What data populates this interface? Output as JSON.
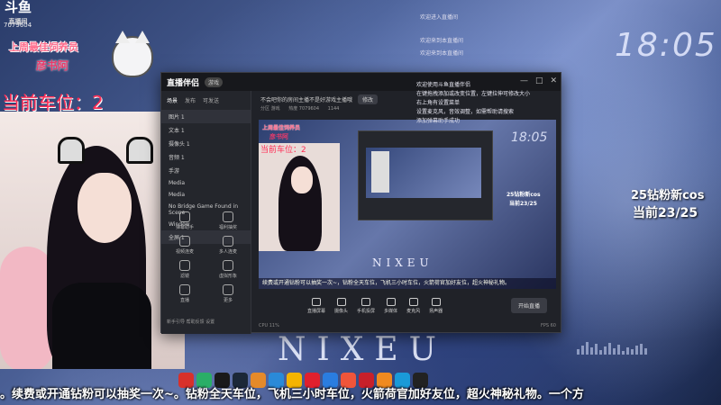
{
  "platform": {
    "logo_text": "斗鱼",
    "logo_sub": "直播间",
    "room_id": "7079604"
  },
  "badge": {
    "title": "上周最佳饲养员",
    "name": "彦书阿"
  },
  "car_position": "当前车位：2",
  "desktop": {
    "clock": "18:05",
    "brand": "NIXEU"
  },
  "overlay_right": {
    "line1": "25钻粉新cos",
    "line2": "当前23/25"
  },
  "notifications": [
    "欢迎进入直播间",
    "欢迎来到本直播间",
    "欢迎来到本直播间"
  ],
  "app": {
    "title": "直播伴侣",
    "version": "游戏",
    "window_controls": [
      "—",
      "□",
      "✕"
    ],
    "sidebar_tabs": [
      "场景",
      "发布",
      "可发送"
    ],
    "scenes": [
      {
        "label": "图片 1"
      },
      {
        "label": "文本 1"
      },
      {
        "label": "摄像头 1"
      },
      {
        "label": "音频 1"
      },
      {
        "label": "手游"
      },
      {
        "label": "Media"
      },
      {
        "label": "Media"
      },
      {
        "label": "No Bridge Game Found in Scene"
      },
      {
        "label": "Window"
      },
      {
        "label": "全屏 1"
      }
    ],
    "tools": [
      {
        "label": "弹幕助手",
        "icon": "headphones-icon"
      },
      {
        "label": "福利抽奖",
        "icon": "gift-icon"
      },
      {
        "label": "视频连麦",
        "icon": "video-call-icon"
      },
      {
        "label": "多人连麦",
        "icon": "group-icon"
      },
      {
        "label": "滤镜",
        "icon": "filter-icon"
      },
      {
        "label": "虚拟形象",
        "icon": "avatar-icon"
      },
      {
        "label": "直播",
        "icon": "broadcast-icon"
      },
      {
        "label": "更多",
        "icon": "more-icon"
      }
    ],
    "sidebar_footer": "新手引导  帮助反馈  设置",
    "top_info": "不会吧你的房间主播不是好游戏主播哦",
    "top_info_btn": "修改",
    "sub_info": [
      "分区 游戏",
      "热度 7079604",
      "1144"
    ],
    "toolbar": [
      {
        "label": "直播屏幕",
        "icon": "screen-icon"
      },
      {
        "label": "摄像头",
        "icon": "camera-icon"
      },
      {
        "label": "手机投屏",
        "icon": "phone-icon"
      },
      {
        "label": "多媒体",
        "icon": "media-icon"
      },
      {
        "label": "麦克风",
        "icon": "mic-icon"
      },
      {
        "label": "扬声器",
        "icon": "speaker-icon"
      }
    ],
    "start_button": "开始直播",
    "status_left": "CPU 11%",
    "status_right": "FPS 60"
  },
  "preview": {
    "badge_title": "上周最佳饲养员",
    "badge_name": "彦书阿",
    "car": "当前车位：2",
    "clock": "18:05",
    "brand": "NIXEU",
    "ov1": "25钻粉新cos",
    "ov2": "当前23/25",
    "ticker": "续费或开通钻粉可以抽奖一次~，钻粉全天车位，飞机三小时车位，火箭荷官加好友位，超火神秘礼物。"
  },
  "chat": [
    "欢迎使用斗鱼直播伴侣",
    "在键拖拽添加或改变位置，左键拉伸可修改大小",
    "右上角有设置菜单",
    "设置麦克风，音效调整，如需帮助请搜索",
    "添加弹幕助手成功"
  ],
  "ticker": "。续费或开通钻粉可以抽奖一次~。钻粉全天车位，飞机三小时车位，火箭荷官加好友位，超火神秘礼物。一个方",
  "taskbar_icons": [
    {
      "name": "wegame-icon",
      "color": "#d8302a"
    },
    {
      "name": "wechat-icon",
      "color": "#2aae67"
    },
    {
      "name": "qq-icon",
      "color": "#1a1a1a"
    },
    {
      "name": "steam-icon",
      "color": "#1b2838"
    },
    {
      "name": "game-icon",
      "color": "#e58a2a"
    },
    {
      "name": "nb-icon",
      "color": "#2a8ad8"
    },
    {
      "name": "douyu-icon",
      "color": "#f4b400"
    },
    {
      "name": "netease-music-icon",
      "color": "#e0202e"
    },
    {
      "name": "kugou-icon",
      "color": "#2a7de0"
    },
    {
      "name": "browser-icon",
      "color": "#f0553a"
    },
    {
      "name": "toolbox-icon",
      "color": "#c8202a"
    },
    {
      "name": "orange-icon",
      "color": "#f08a20"
    },
    {
      "name": "edge-icon",
      "color": "#1a9ad8"
    },
    {
      "name": "app-icon",
      "color": "#222"
    }
  ]
}
